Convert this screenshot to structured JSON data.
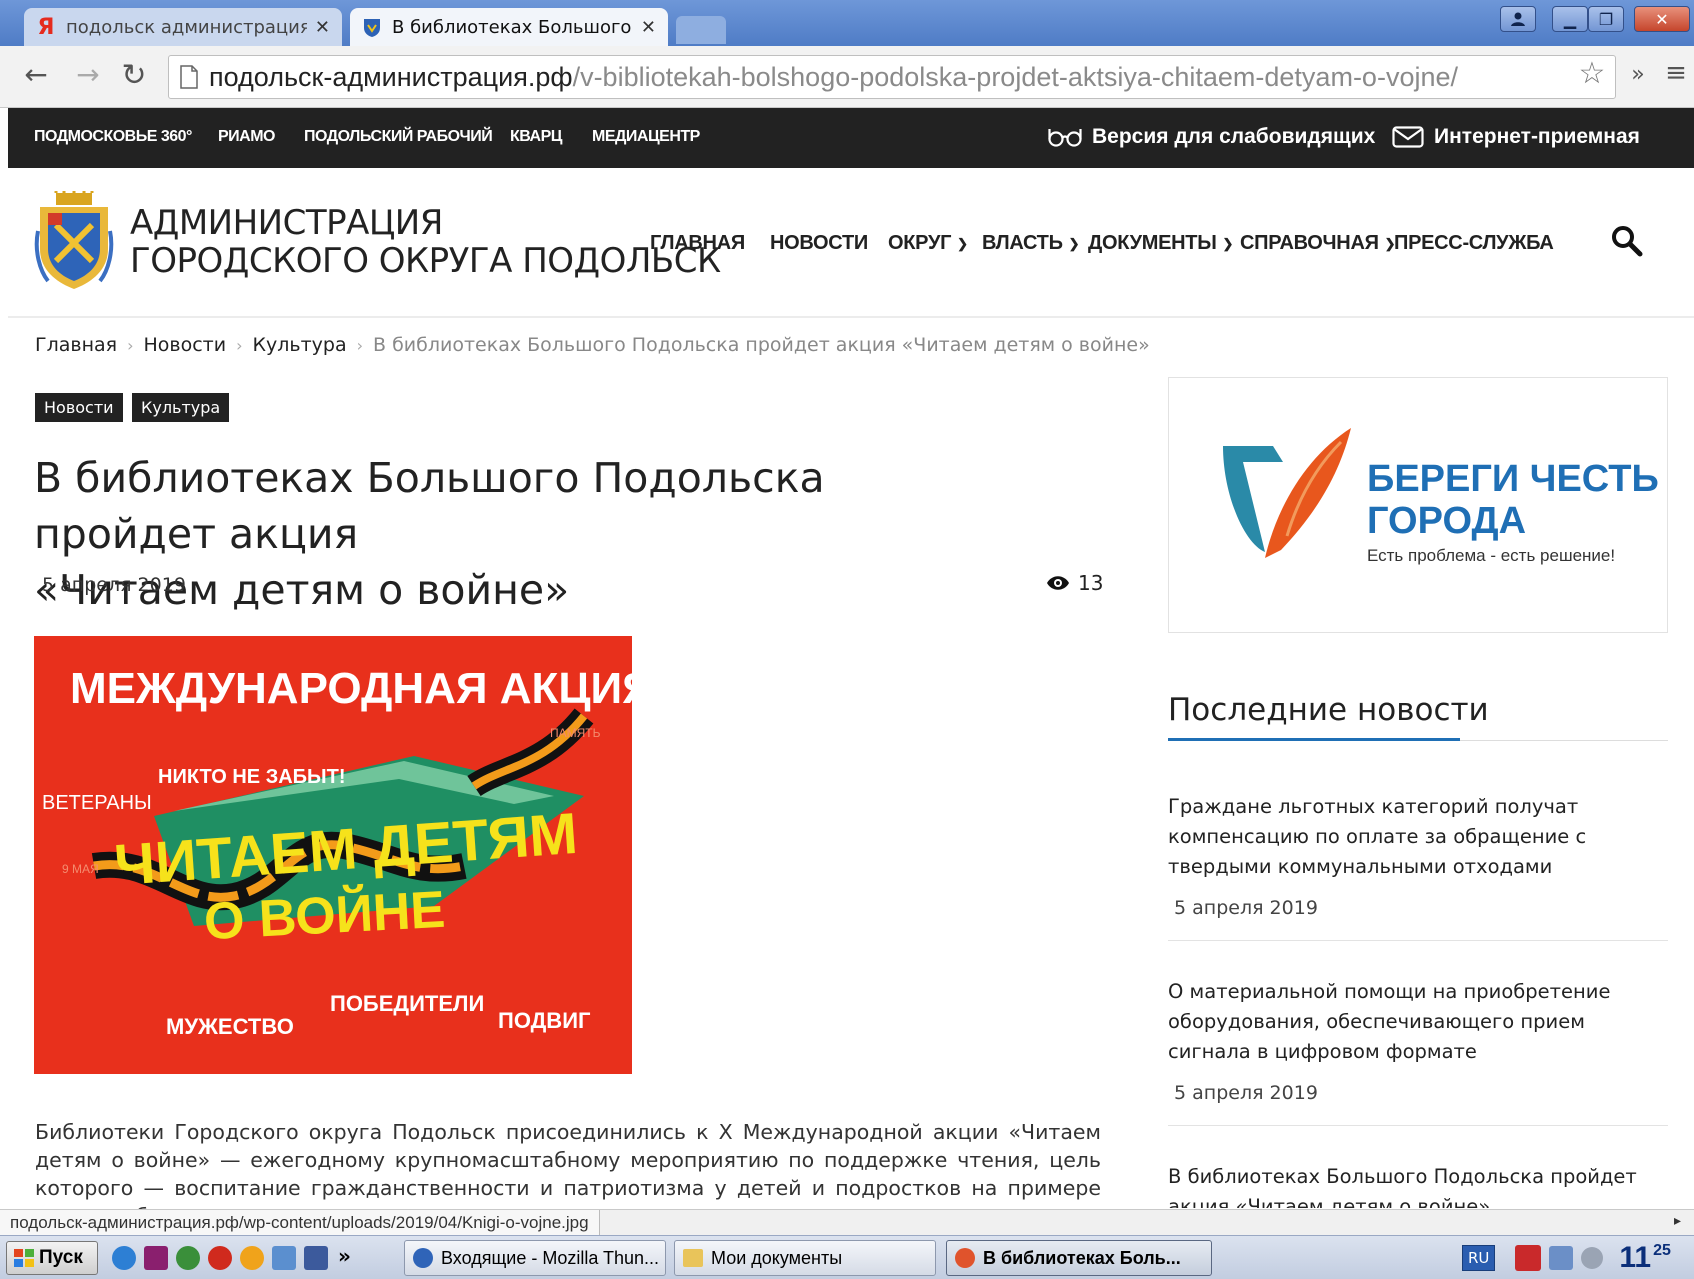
{
  "browser": {
    "tabs": [
      {
        "title": "подольск администрация р",
        "icon": "yandex-icon",
        "active": false
      },
      {
        "title": "В библиотеках Большого П",
        "icon": "site-favicon",
        "active": true
      }
    ],
    "url_host": "подольск-администрация.рф",
    "url_path": "/v-bibliotekah-bolshogo-podolska-projdet-aktsiya-chitaem-detyam-o-vojne/",
    "status_url": "подольск-администрация.рф/wp-content/uploads/2019/04/Knigi-o-vojne.jpg"
  },
  "topbar": {
    "links": [
      "ПОДМОСКОВЬЕ 360°",
      "РИАМО",
      "ПОДОЛЬСКИЙ РАБОЧИЙ",
      "КВАРЦ",
      "МЕДИАЦЕНТР"
    ],
    "accessibility": "Версия для слабовидящих",
    "reception": "Интернет-приемная"
  },
  "header": {
    "site_name_1": "АДМИНИСТРАЦИЯ",
    "site_name_2": "ГОРОДСКОГО ОКРУГА ПОДОЛЬСК",
    "nav": [
      "ГЛАВНАЯ",
      "НОВОСТИ",
      "ОКРУГ",
      "ВЛАСТЬ",
      "ДОКУМЕНТЫ",
      "СПРАВОЧНАЯ",
      "ПРЕСС-СЛУЖБА"
    ]
  },
  "breadcrumb": [
    "Главная",
    "Новости",
    "Культура",
    "В библиотеках Большого Подольска пройдет акция «Читаем детям о войне»"
  ],
  "article": {
    "categories": [
      "Новости",
      "Культура"
    ],
    "title_line1": "В библиотеках Большого Подольска пройдет акция",
    "title_line2": "«Читаем детям о войне»",
    "date": "5 апреля 2019",
    "views": "13",
    "image_text": {
      "headline": "МЕЖДУНАРОДНАЯ АКЦИЯ",
      "main1": "ЧИТАЕМ ДЕТЯМ",
      "main2": "О ВОЙНЕ",
      "words": [
        "НИКТО НЕ ЗАБЫТ!",
        "ВЕТЕРАНЫ",
        "ПОБЕДИТЕЛИ",
        "МУЖЕСТВО",
        "ПОДВИГ",
        "ПАМЯТЬ",
        "9 МАЯ"
      ]
    },
    "body": "Библиотеки Городского округа Подольск присоединились к X Международной акции «Читаем детям о войне» — ежегодному крупномасштабному мероприятию по поддержке чтения, цель которого — воспитание гражданственности и патриотизма у детей и подростков на примере лучших образцов"
  },
  "sidebar": {
    "banner_title_1": "БЕРЕГИ ЧЕСТЬ",
    "banner_title_2": "ГОРОДА",
    "banner_sub": "Есть проблема - есть решение!",
    "latest_title": "Последние новости",
    "news": [
      {
        "title": "Граждане льготных категорий получат компенсацию по оплате за обращение с твердыми коммунальными отходами",
        "date": "5 апреля 2019"
      },
      {
        "title": "О материальной помощи на приобретение оборудования, обеспечивающего прием сигнала в цифровом формате",
        "date": "5 апреля 2019"
      },
      {
        "title": "В библиотеках Большого Подольска пройдет акция «Читаем детям о войне»",
        "date": ""
      }
    ]
  },
  "taskbar": {
    "start": "Пуск",
    "tasks": [
      "Входящие - Mozilla Thun...",
      "Мои документы",
      "В библиотеках Боль..."
    ],
    "lang": "RU",
    "clock": "11",
    "clock_min": "25"
  },
  "colors": {
    "accent": "#1f6fb5",
    "topbar": "#222222",
    "image_red": "#e8301c"
  }
}
